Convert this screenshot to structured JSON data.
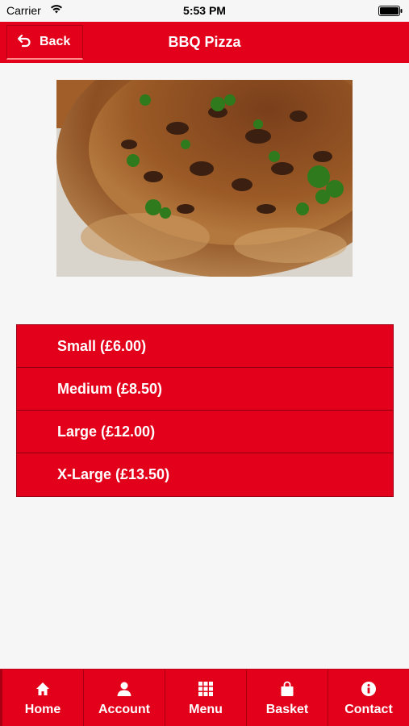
{
  "status_bar": {
    "carrier": "Carrier",
    "time": "5:53 PM",
    "icons": [
      "wifi-icon",
      "battery-icon"
    ]
  },
  "nav": {
    "back_label": "Back",
    "back_icon": "return-arrow-icon",
    "title": "BBQ Pizza"
  },
  "product_image": {
    "icon": "pizza-photo"
  },
  "sizes": [
    {
      "label": "Small (£6.00)"
    },
    {
      "label": "Medium (£8.50)"
    },
    {
      "label": "Large (£12.00)"
    },
    {
      "label": "X-Large (£13.50)"
    }
  ],
  "tab_bar": {
    "items": [
      {
        "label": "Home",
        "icon": "home-icon"
      },
      {
        "label": "Account",
        "icon": "user-icon"
      },
      {
        "label": "Menu",
        "icon": "grid-icon"
      },
      {
        "label": "Basket",
        "icon": "shopping-bag-icon"
      },
      {
        "label": "Contact",
        "icon": "info-icon"
      }
    ]
  },
  "colors": {
    "brand_red": "#e3001b",
    "background": "#f6f6f6",
    "text_on_red": "#ffffff"
  }
}
